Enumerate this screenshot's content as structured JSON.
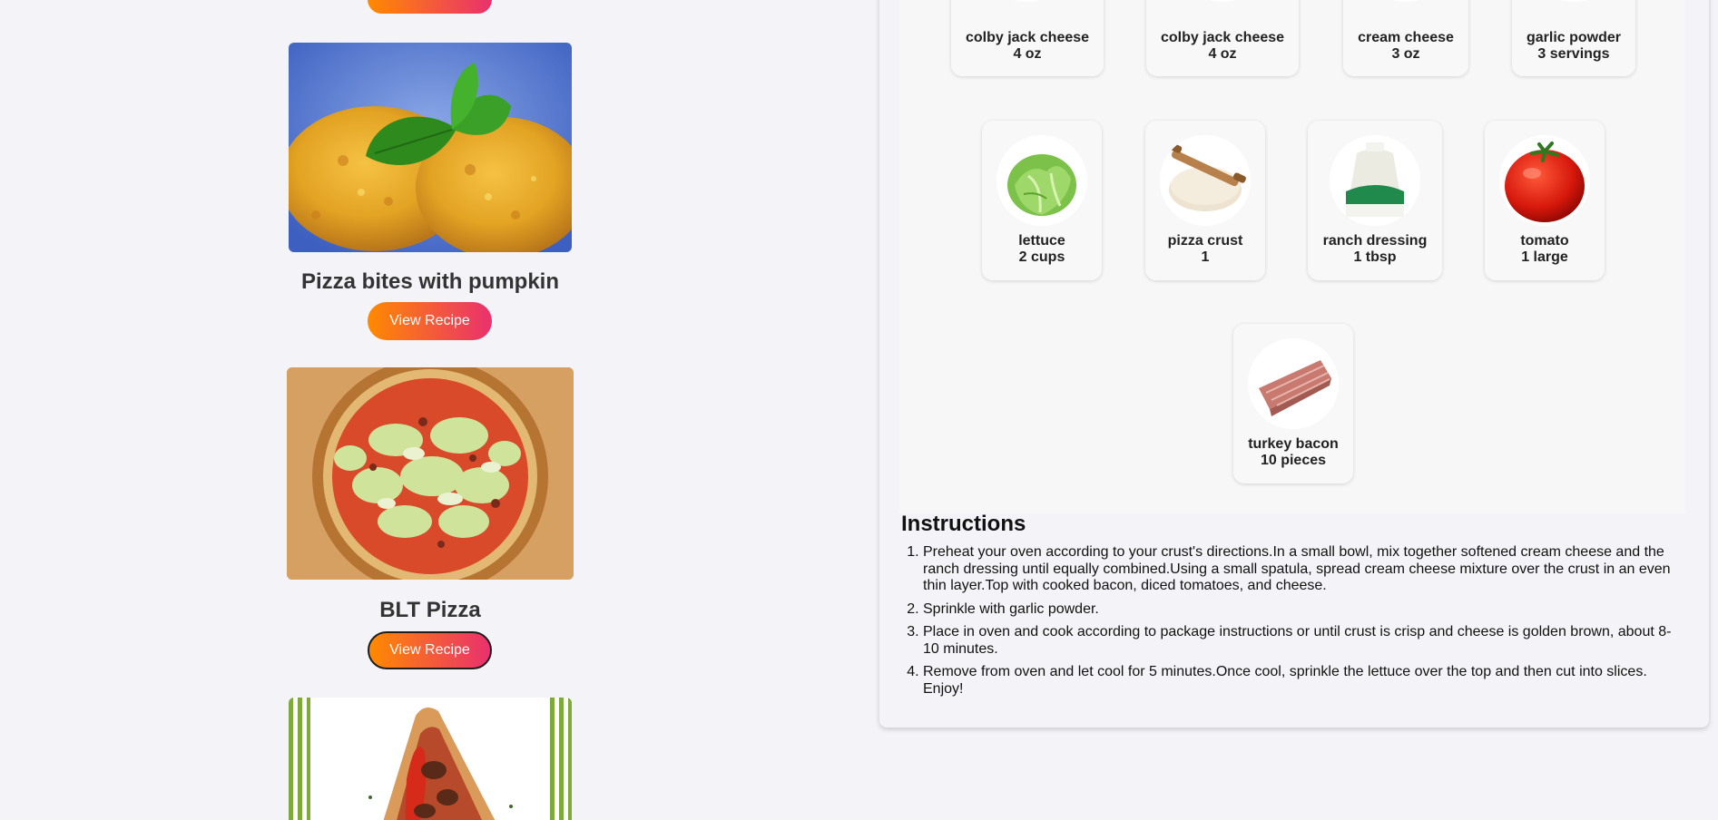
{
  "recipes": [
    {
      "title": "Pizza bites with pumpkin",
      "button_label": "View Recipe"
    },
    {
      "title": "BLT Pizza",
      "button_label": "View Recipe"
    },
    {
      "title": "",
      "button_label": ""
    }
  ],
  "ingredients": [
    {
      "name": "colby jack cheese",
      "quantity": "4 oz",
      "icon": "cheese-icon"
    },
    {
      "name": "colby jack cheese",
      "quantity": "4 oz",
      "icon": "cheese-icon"
    },
    {
      "name": "cream cheese",
      "quantity": "3 oz",
      "icon": "cream-cheese-icon"
    },
    {
      "name": "garlic powder",
      "quantity": "3 servings",
      "icon": "garlic-powder-icon"
    },
    {
      "name": "lettuce",
      "quantity": "2 cups",
      "icon": "lettuce-icon"
    },
    {
      "name": "pizza crust",
      "quantity": "1",
      "icon": "pizza-crust-icon"
    },
    {
      "name": "ranch dressing",
      "quantity": "1 tbsp",
      "icon": "ranch-dressing-icon"
    },
    {
      "name": "tomato",
      "quantity": "1 large",
      "icon": "tomato-icon"
    },
    {
      "name": "turkey bacon",
      "quantity": "10 pieces",
      "icon": "turkey-bacon-icon"
    }
  ],
  "instructions": {
    "heading": "Instructions",
    "steps": [
      "Preheat your oven according to your crust's directions.In a small bowl, mix together softened cream cheese and the ranch dressing until equally combined.Using a small spatula, spread cream cheese mixture over the crust in an even thin layer.Top with cooked bacon, diced tomatoes, and cheese.",
      "Sprinkle with garlic powder.",
      "Place in oven and cook according to package instructions or until crust is crisp and cheese is golden brown, about 8-10 minutes.",
      "Remove from oven and let cool for 5 minutes.Once cool, sprinkle the lettuce over the top and then cut into slices. Enjoy!"
    ]
  },
  "colors": {
    "button_gradient_start": "#ff8a00",
    "button_gradient_end": "#e9306e",
    "page_background": "#f4f4f8"
  }
}
